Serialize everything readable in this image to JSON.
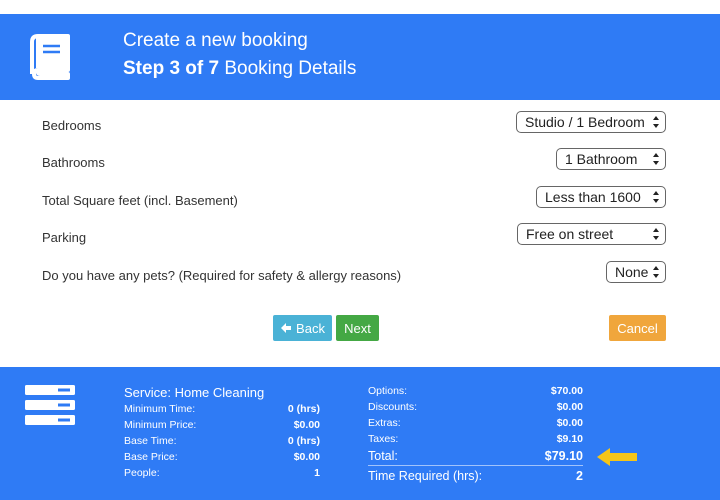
{
  "header": {
    "title": "Create a new booking",
    "step_bold": "Step 3 of 7",
    "step_rest": " Booking Details",
    "icon": "book-icon"
  },
  "form": {
    "rows": [
      {
        "label": "Bedrooms",
        "value": "Studio / 1 Bedroom"
      },
      {
        "label": "Bathrooms",
        "value": "1 Bathroom"
      },
      {
        "label": "Total Square feet (incl. Basement)",
        "value": "Less than 1600"
      },
      {
        "label": "Parking",
        "value": "Free on street"
      },
      {
        "label": "Do you have any pets? (Required for safety & allergy reasons)",
        "value": "None"
      }
    ]
  },
  "buttons": {
    "back": "Back",
    "back_icon": "arrow-left-icon",
    "next": "Next",
    "cancel": "Cancel"
  },
  "colors": {
    "brand_blue": "#2f7bf5",
    "back": "#4ab2d6",
    "next": "#44a844",
    "cancel": "#f0a63c",
    "arrow": "#f5c518"
  },
  "summary": {
    "service": "Service: Home Cleaning",
    "left": [
      {
        "key": "Minimum Time:",
        "value": "0 (hrs)"
      },
      {
        "key": "Minimum Price:",
        "value": "$0.00"
      },
      {
        "key": "Base Time:",
        "value": "0 (hrs)"
      },
      {
        "key": "Base Price:",
        "value": "$0.00"
      },
      {
        "key": "People:",
        "value": "1"
      }
    ],
    "right": [
      {
        "key": "Options:",
        "value": "$70.00"
      },
      {
        "key": "Discounts:",
        "value": "$0.00"
      },
      {
        "key": "Extras:",
        "value": "$0.00"
      },
      {
        "key": "Taxes:",
        "value": "$9.10"
      },
      {
        "key": "Total:",
        "value": "$79.10"
      },
      {
        "key": "Time Required (hrs):",
        "value": "2"
      }
    ]
  }
}
